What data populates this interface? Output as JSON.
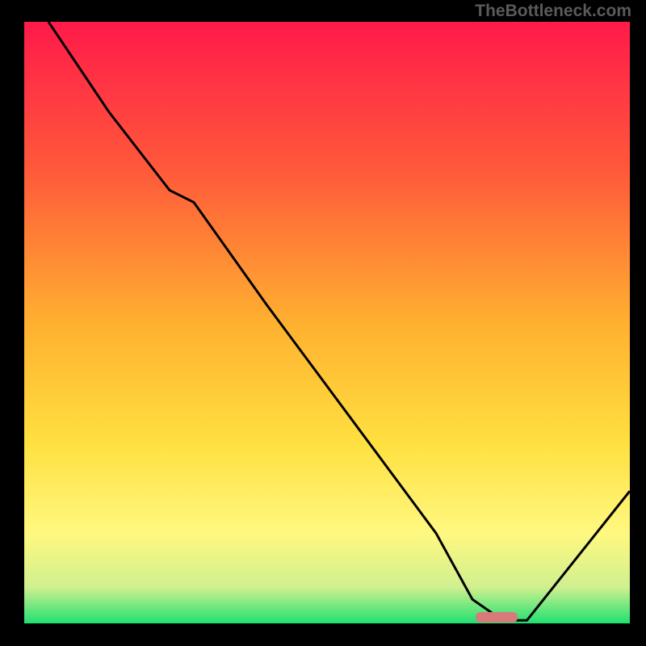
{
  "watermark": "TheBottleneck.com",
  "chart_data": {
    "type": "line",
    "title": "",
    "xlabel": "",
    "ylabel": "",
    "xlim": [
      0,
      100
    ],
    "ylim": [
      0,
      100
    ],
    "x": [
      4,
      14,
      24,
      28,
      40,
      54,
      68,
      74,
      79,
      83,
      100
    ],
    "values": [
      100,
      85,
      72,
      70,
      53,
      34,
      15,
      4,
      0.5,
      0.5,
      22
    ],
    "optimal_zone": {
      "x_start": 74,
      "x_end": 83,
      "y": 0.5
    },
    "gradient_stops": [
      {
        "offset": 0,
        "color": "#ff1a4a"
      },
      {
        "offset": 25,
        "color": "#ff5a3a"
      },
      {
        "offset": 50,
        "color": "#ffb030"
      },
      {
        "offset": 70,
        "color": "#ffe040"
      },
      {
        "offset": 85,
        "color": "#fff880"
      },
      {
        "offset": 94,
        "color": "#d0f090"
      },
      {
        "offset": 100,
        "color": "#20e070"
      }
    ],
    "marker": {
      "x": 78,
      "y": 1,
      "color": "#d77a7a"
    }
  }
}
